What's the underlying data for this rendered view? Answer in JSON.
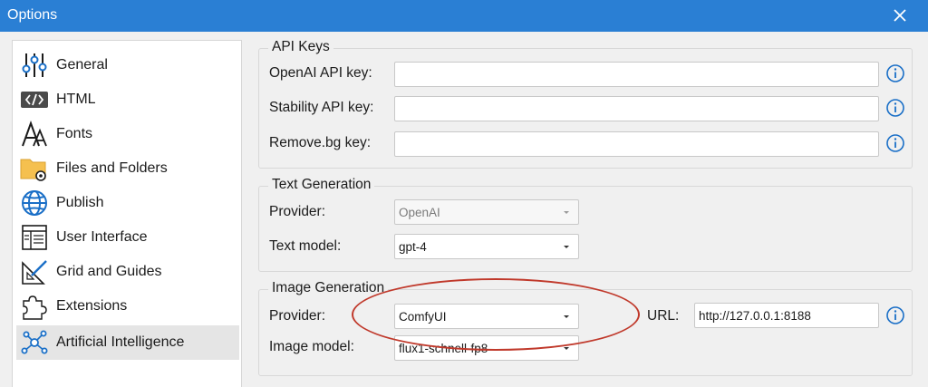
{
  "window": {
    "title": "Options"
  },
  "sidebar": {
    "items": [
      {
        "label": "General",
        "icon": "sliders-icon"
      },
      {
        "label": "HTML",
        "icon": "code-tag-icon"
      },
      {
        "label": "Fonts",
        "icon": "font-icon"
      },
      {
        "label": "Files and Folders",
        "icon": "folder-gear-icon"
      },
      {
        "label": "Publish",
        "icon": "globe-icon"
      },
      {
        "label": "User Interface",
        "icon": "window-layout-icon"
      },
      {
        "label": "Grid and Guides",
        "icon": "ruler-triangle-icon"
      },
      {
        "label": "Extensions",
        "icon": "puzzle-icon"
      },
      {
        "label": "Artificial Intelligence",
        "icon": "network-nodes-icon",
        "selected": true
      }
    ]
  },
  "api_keys": {
    "title": "API Keys",
    "openai_label": "OpenAI API key:",
    "openai_value": "",
    "stability_label": "Stability API key:",
    "stability_value": "",
    "removebg_label": "Remove.bg key:",
    "removebg_value": ""
  },
  "text_generation": {
    "title": "Text Generation",
    "provider_label": "Provider:",
    "provider_value": "OpenAI",
    "model_label": "Text model:",
    "model_value": "gpt-4"
  },
  "image_generation": {
    "title": "Image Generation",
    "provider_label": "Provider:",
    "provider_value": "ComfyUI",
    "url_label": "URL:",
    "url_value": "http://127.0.0.1:8188",
    "model_label": "Image model:",
    "model_value": "flux1-schnell-fp8"
  },
  "colors": {
    "titlebar": "#2a7fd4",
    "info_icon": "#1a6fc7",
    "annotation": "#c0392b"
  }
}
